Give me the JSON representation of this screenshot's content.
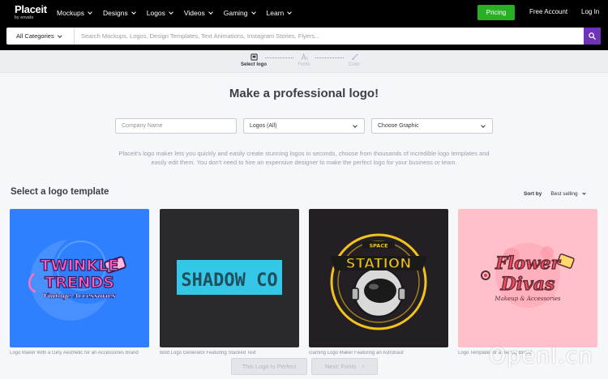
{
  "nav": {
    "brand": "Placeit",
    "brand_sub": "by envato",
    "menu": [
      "Mockups",
      "Designs",
      "Logos",
      "Videos",
      "Gaming",
      "Learn"
    ],
    "pricing": "Pricing",
    "free_account": "Free Account",
    "login": "Log In"
  },
  "search": {
    "category": "All Categories",
    "placeholder": "Search Mockups, Logos, Design Templates, Text Animations, Instagram Stories, Flyers..."
  },
  "steps": [
    {
      "label": "Select logo",
      "state": "active",
      "icon": "logo-icon"
    },
    {
      "label": "Fonts",
      "state": "inactive",
      "icon": "font-icon"
    },
    {
      "label": "Color",
      "state": "inactive",
      "icon": "brush-icon"
    }
  ],
  "main": {
    "headline": "Make a professional logo!",
    "company_placeholder": "Company Name",
    "logos_select": "Logos (All)",
    "graphic_select": "Choose Graphic",
    "intro": "Placeit's logo maker lets you quickly and easily create stunning logos in seconds, choose from thousands of incredible logo templates and easily edit them. You don't need to hire an expensive designer to make the perfect logo for your business or team."
  },
  "templates": {
    "title": "Select a logo template",
    "sort_label": "Sort by",
    "sort_value": "Best selling",
    "cards": [
      {
        "logo_line1": "TWINKLE",
        "logo_line2": "TRENDS",
        "logo_line3": "Vintage Accessories",
        "caption": "Logo Maker With a Girly Aesthetic for an Accessories Brand",
        "bg": "#2f80ff"
      },
      {
        "logo_line1": "SHADOW CO",
        "caption": "Bold Logo Generator Featuring Stacked Text",
        "bg": "#2a2a2c"
      },
      {
        "logo_top": "SPACE",
        "logo_line1": "STATION",
        "caption": "Gaming Logo Maker Featuring an Astronaut",
        "bg": "#231f24"
      },
      {
        "logo_line1": "Flower",
        "logo_line2": "Divas",
        "logo_line3": "Makeup & Accessories",
        "caption": "Logo Template for a Beauty Brand",
        "bg": "#ffc0c9"
      }
    ]
  },
  "footer": {
    "perfect_button": "This Logo Is Perfect",
    "next_button": "Next: Fonts",
    "watermark": "OpenI.cn"
  }
}
